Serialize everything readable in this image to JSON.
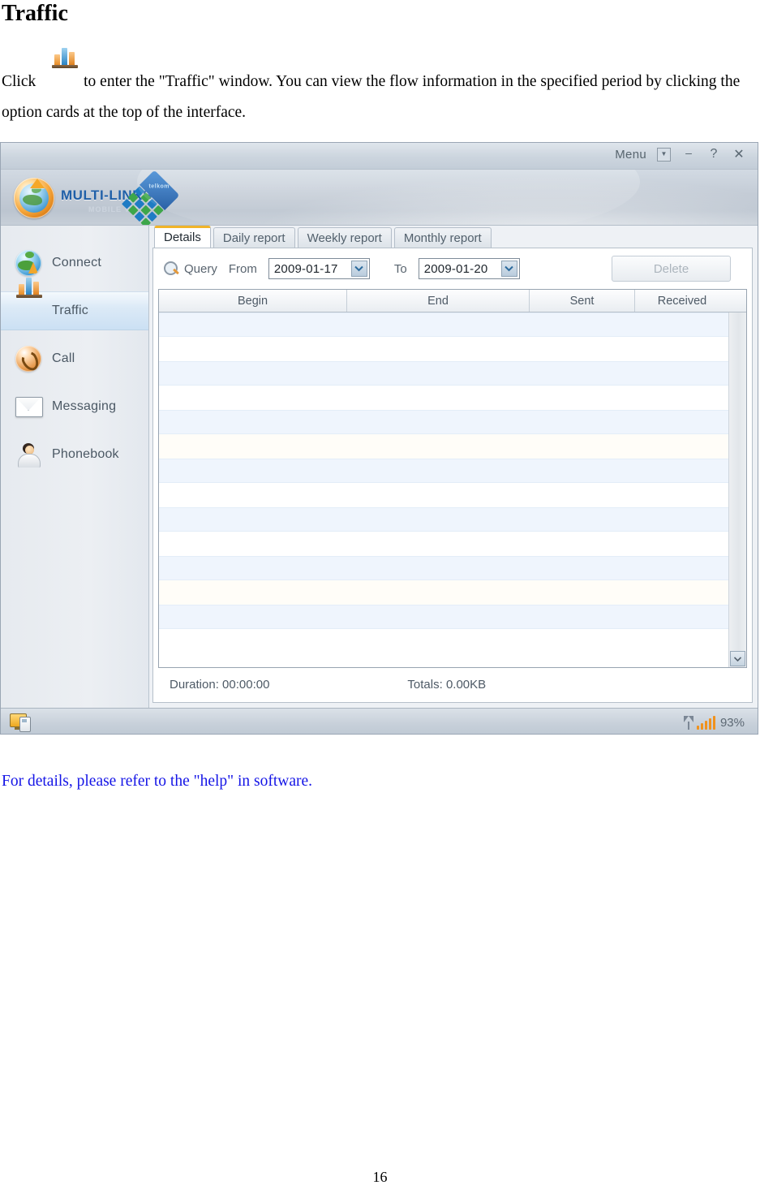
{
  "document": {
    "heading": "Traffic",
    "paragraph_prefix": "Click",
    "paragraph_body": "to enter the \"Traffic\" window. You can view the flow information in the specified period by clicking the option cards at the top of the interface.",
    "inline_icon": "traffic-bar-chart-icon",
    "footnote": "For details, please refer to the \"help\" in software.",
    "page_number": "16"
  },
  "app": {
    "titlebar": {
      "menu_label": "Menu",
      "menu_caret": "▼",
      "minimize_label": "–",
      "help_label": "?",
      "close_label": "✕"
    },
    "brand": {
      "name": "MULTI-LINKS",
      "tagline": "MOBILE VIP",
      "diamond_label": "telkom",
      "logo_icon": "globe-refresh-logo-icon"
    },
    "sidebar": {
      "items": [
        {
          "label": "Connect",
          "icon": "globe-arrow-icon",
          "selected": false
        },
        {
          "label": "Traffic",
          "icon": "bar-chart-icon",
          "selected": true
        },
        {
          "label": "Call",
          "icon": "phone-handset-icon",
          "selected": false
        },
        {
          "label": "Messaging",
          "icon": "envelope-icon",
          "selected": false
        },
        {
          "label": "Phonebook",
          "icon": "person-icon",
          "selected": false
        }
      ]
    },
    "tabs": [
      {
        "label": "Details",
        "active": true
      },
      {
        "label": "Daily report",
        "active": false
      },
      {
        "label": "Weekly report",
        "active": false
      },
      {
        "label": "Monthly report",
        "active": false
      }
    ],
    "querybar": {
      "search_icon": "magnifier-icon",
      "query_label": "Query",
      "from_label": "From",
      "from_value": "2009-01-17",
      "to_label": "To",
      "to_value": "2009-01-20",
      "dropdown_icon": "chevron-down-icon",
      "delete_label": "Delete",
      "delete_enabled": false
    },
    "table": {
      "columns": [
        "Begin",
        "End",
        "Sent",
        "Received"
      ],
      "rows": []
    },
    "table_footer": {
      "duration": "Duration: 00:00:00",
      "totals": "Totals: 0.00KB"
    },
    "statusbar": {
      "device_icon": "pc-modem-connection-icon",
      "signal_icon": "signal-strength-icon",
      "signal_percent": "93%"
    },
    "colors": {
      "accent_tab": "#f0b429",
      "brand_blue": "#1f5fa8",
      "signal_orange": "#f0921e",
      "row_stripe": "#eff5fd",
      "footnote_blue": "#1414e6"
    }
  }
}
